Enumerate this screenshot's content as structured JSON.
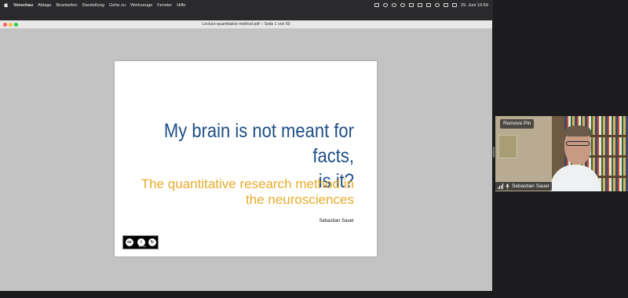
{
  "menubar": {
    "items": [
      "Vorschau",
      "Ablage",
      "Bearbeiten",
      "Darstellung",
      "Gehe zu",
      "Werkzeuge",
      "Fenster",
      "Hilfe"
    ],
    "datetime": "29. Juni 16:59"
  },
  "window": {
    "title": "Lecture-quantitative-method.pdf – Seite 1 von 60"
  },
  "slide": {
    "title_line1": "My brain is not meant for facts,",
    "title_line2": "is it?",
    "subtitle_line1": "The quantitative research method in",
    "subtitle_line2": "the neurosciences",
    "author": "Sebastian Sauer",
    "license_text": "BY SA",
    "colors": {
      "title": "#1d4f86",
      "subtitle": "#e9ac2b"
    }
  },
  "video": {
    "remove_pin_label": "Remove Pin",
    "participant_name": "Sebastian Sauer"
  }
}
